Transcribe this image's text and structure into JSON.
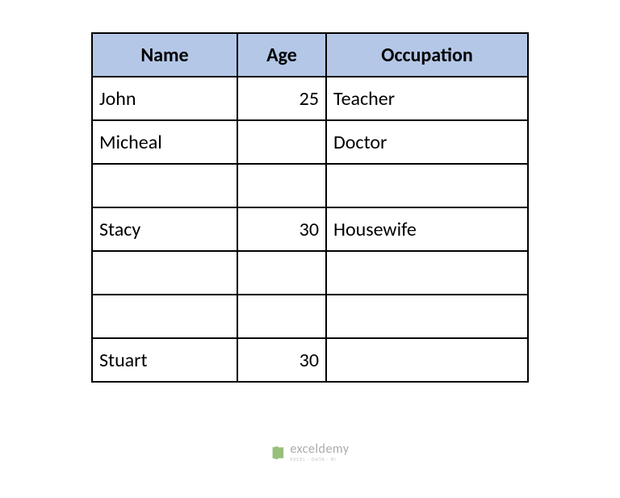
{
  "chart_data": {
    "type": "table",
    "columns": [
      "Name",
      "Age",
      "Occupation"
    ],
    "rows": [
      {
        "name": "John",
        "age": 25,
        "occupation": "Teacher"
      },
      {
        "name": "Micheal",
        "age": "",
        "occupation": "Doctor"
      },
      {
        "name": "",
        "age": "",
        "occupation": ""
      },
      {
        "name": "Stacy",
        "age": 30,
        "occupation": "Housewife"
      },
      {
        "name": "",
        "age": "",
        "occupation": ""
      },
      {
        "name": "",
        "age": "",
        "occupation": ""
      },
      {
        "name": "Stuart",
        "age": 30,
        "occupation": ""
      }
    ]
  },
  "table": {
    "headers": {
      "name": "Name",
      "age": "Age",
      "occupation": "Occupation"
    },
    "rows": [
      {
        "name": "John",
        "age": "25",
        "occupation": "Teacher"
      },
      {
        "name": "Micheal",
        "age": "",
        "occupation": "Doctor"
      },
      {
        "name": "",
        "age": "",
        "occupation": ""
      },
      {
        "name": "Stacy",
        "age": "30",
        "occupation": "Housewife"
      },
      {
        "name": "",
        "age": "",
        "occupation": ""
      },
      {
        "name": "",
        "age": "",
        "occupation": ""
      },
      {
        "name": "Stuart",
        "age": "30",
        "occupation": ""
      }
    ]
  },
  "watermark": {
    "main": "exceldemy",
    "sub": "EXCEL · DATA · BI"
  }
}
